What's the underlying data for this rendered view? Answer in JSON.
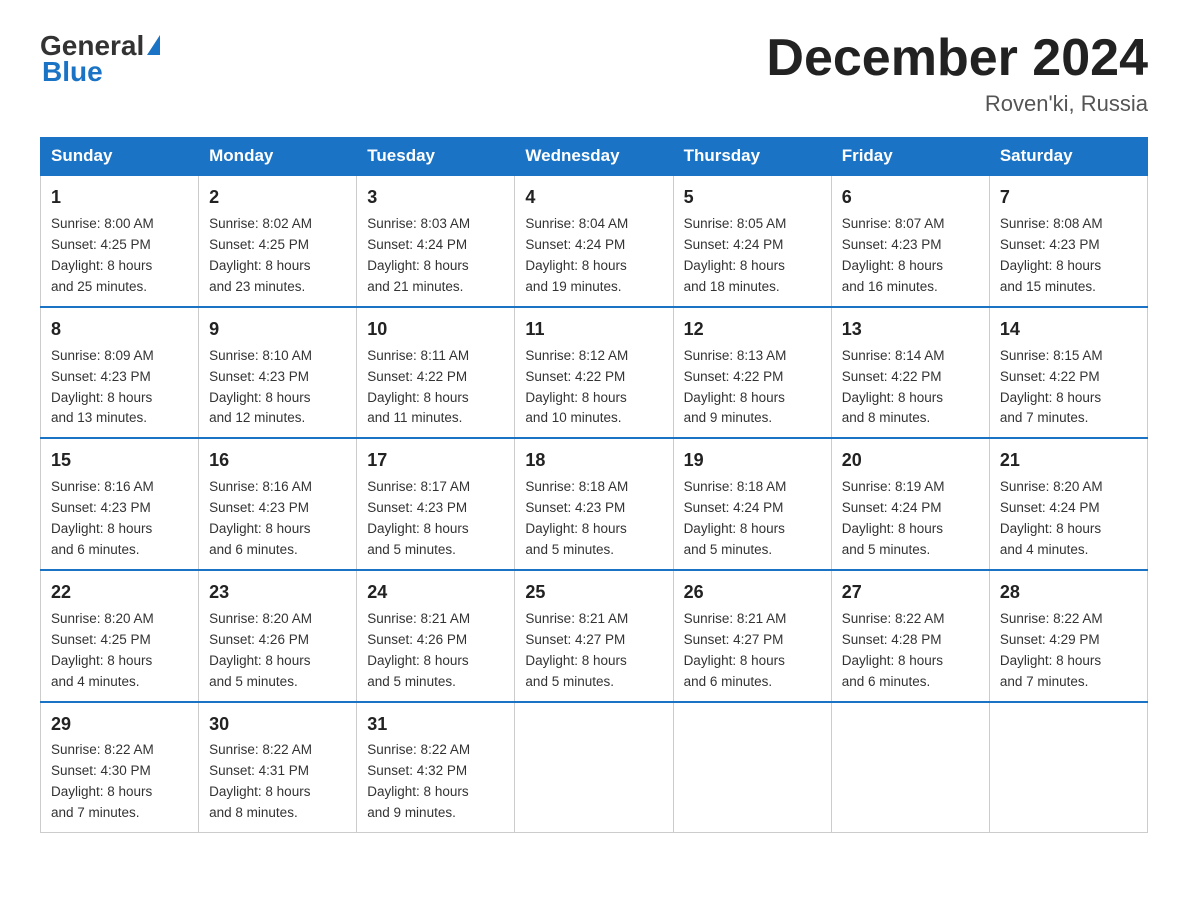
{
  "header": {
    "logo_general": "General",
    "logo_blue": "Blue",
    "month_title": "December 2024",
    "location": "Roven'ki, Russia"
  },
  "days_of_week": [
    "Sunday",
    "Monday",
    "Tuesday",
    "Wednesday",
    "Thursday",
    "Friday",
    "Saturday"
  ],
  "weeks": [
    [
      {
        "day": "1",
        "sunrise": "8:00 AM",
        "sunset": "4:25 PM",
        "daylight": "8 hours and 25 minutes."
      },
      {
        "day": "2",
        "sunrise": "8:02 AM",
        "sunset": "4:25 PM",
        "daylight": "8 hours and 23 minutes."
      },
      {
        "day": "3",
        "sunrise": "8:03 AM",
        "sunset": "4:24 PM",
        "daylight": "8 hours and 21 minutes."
      },
      {
        "day": "4",
        "sunrise": "8:04 AM",
        "sunset": "4:24 PM",
        "daylight": "8 hours and 19 minutes."
      },
      {
        "day": "5",
        "sunrise": "8:05 AM",
        "sunset": "4:24 PM",
        "daylight": "8 hours and 18 minutes."
      },
      {
        "day": "6",
        "sunrise": "8:07 AM",
        "sunset": "4:23 PM",
        "daylight": "8 hours and 16 minutes."
      },
      {
        "day": "7",
        "sunrise": "8:08 AM",
        "sunset": "4:23 PM",
        "daylight": "8 hours and 15 minutes."
      }
    ],
    [
      {
        "day": "8",
        "sunrise": "8:09 AM",
        "sunset": "4:23 PM",
        "daylight": "8 hours and 13 minutes."
      },
      {
        "day": "9",
        "sunrise": "8:10 AM",
        "sunset": "4:23 PM",
        "daylight": "8 hours and 12 minutes."
      },
      {
        "day": "10",
        "sunrise": "8:11 AM",
        "sunset": "4:22 PM",
        "daylight": "8 hours and 11 minutes."
      },
      {
        "day": "11",
        "sunrise": "8:12 AM",
        "sunset": "4:22 PM",
        "daylight": "8 hours and 10 minutes."
      },
      {
        "day": "12",
        "sunrise": "8:13 AM",
        "sunset": "4:22 PM",
        "daylight": "8 hours and 9 minutes."
      },
      {
        "day": "13",
        "sunrise": "8:14 AM",
        "sunset": "4:22 PM",
        "daylight": "8 hours and 8 minutes."
      },
      {
        "day": "14",
        "sunrise": "8:15 AM",
        "sunset": "4:22 PM",
        "daylight": "8 hours and 7 minutes."
      }
    ],
    [
      {
        "day": "15",
        "sunrise": "8:16 AM",
        "sunset": "4:23 PM",
        "daylight": "8 hours and 6 minutes."
      },
      {
        "day": "16",
        "sunrise": "8:16 AM",
        "sunset": "4:23 PM",
        "daylight": "8 hours and 6 minutes."
      },
      {
        "day": "17",
        "sunrise": "8:17 AM",
        "sunset": "4:23 PM",
        "daylight": "8 hours and 5 minutes."
      },
      {
        "day": "18",
        "sunrise": "8:18 AM",
        "sunset": "4:23 PM",
        "daylight": "8 hours and 5 minutes."
      },
      {
        "day": "19",
        "sunrise": "8:18 AM",
        "sunset": "4:24 PM",
        "daylight": "8 hours and 5 minutes."
      },
      {
        "day": "20",
        "sunrise": "8:19 AM",
        "sunset": "4:24 PM",
        "daylight": "8 hours and 5 minutes."
      },
      {
        "day": "21",
        "sunrise": "8:20 AM",
        "sunset": "4:24 PM",
        "daylight": "8 hours and 4 minutes."
      }
    ],
    [
      {
        "day": "22",
        "sunrise": "8:20 AM",
        "sunset": "4:25 PM",
        "daylight": "8 hours and 4 minutes."
      },
      {
        "day": "23",
        "sunrise": "8:20 AM",
        "sunset": "4:26 PM",
        "daylight": "8 hours and 5 minutes."
      },
      {
        "day": "24",
        "sunrise": "8:21 AM",
        "sunset": "4:26 PM",
        "daylight": "8 hours and 5 minutes."
      },
      {
        "day": "25",
        "sunrise": "8:21 AM",
        "sunset": "4:27 PM",
        "daylight": "8 hours and 5 minutes."
      },
      {
        "day": "26",
        "sunrise": "8:21 AM",
        "sunset": "4:27 PM",
        "daylight": "8 hours and 6 minutes."
      },
      {
        "day": "27",
        "sunrise": "8:22 AM",
        "sunset": "4:28 PM",
        "daylight": "8 hours and 6 minutes."
      },
      {
        "day": "28",
        "sunrise": "8:22 AM",
        "sunset": "4:29 PM",
        "daylight": "8 hours and 7 minutes."
      }
    ],
    [
      {
        "day": "29",
        "sunrise": "8:22 AM",
        "sunset": "4:30 PM",
        "daylight": "8 hours and 7 minutes."
      },
      {
        "day": "30",
        "sunrise": "8:22 AM",
        "sunset": "4:31 PM",
        "daylight": "8 hours and 8 minutes."
      },
      {
        "day": "31",
        "sunrise": "8:22 AM",
        "sunset": "4:32 PM",
        "daylight": "8 hours and 9 minutes."
      },
      null,
      null,
      null,
      null
    ]
  ],
  "labels": {
    "sunrise": "Sunrise:",
    "sunset": "Sunset:",
    "daylight": "Daylight:"
  }
}
